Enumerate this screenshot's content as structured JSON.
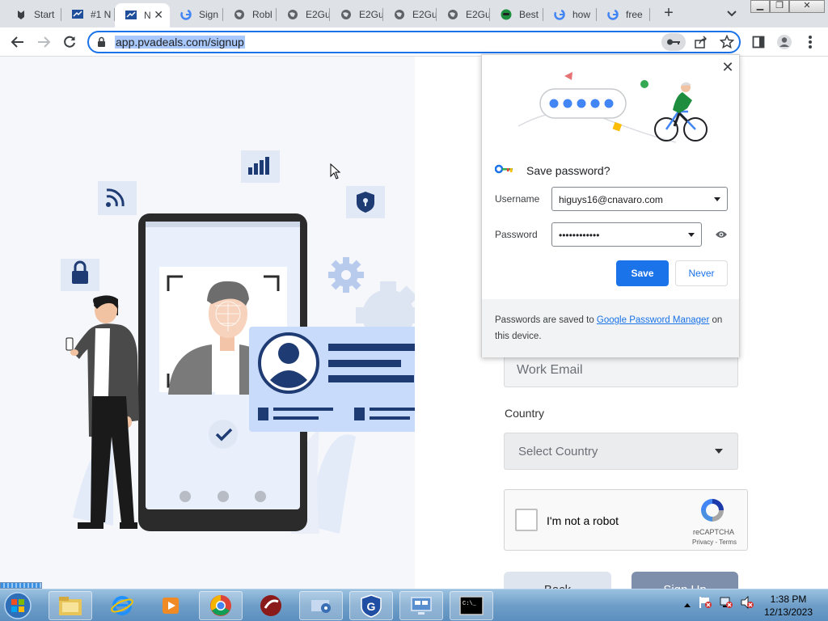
{
  "browser": {
    "tabs": [
      {
        "label": "Start",
        "icon": "owl-favicon"
      },
      {
        "label": "#1 N",
        "icon": "flag-favicon"
      },
      {
        "label": "N",
        "icon": "flag-favicon",
        "active": true
      },
      {
        "label": "Sign",
        "icon": "google-favicon"
      },
      {
        "label": "Robl",
        "icon": "globe-favicon"
      },
      {
        "label": "E2Gu",
        "icon": "globe-favicon"
      },
      {
        "label": "E2Gu",
        "icon": "globe-favicon"
      },
      {
        "label": "E2Gu",
        "icon": "globe-favicon"
      },
      {
        "label": "E2Gu",
        "icon": "globe-favicon"
      },
      {
        "label": "Best",
        "icon": "mask-favicon"
      },
      {
        "label": "how",
        "icon": "google-favicon"
      },
      {
        "label": "free",
        "icon": "google-favicon"
      }
    ],
    "url": "app.pvadeals.com/signup"
  },
  "form": {
    "email_placeholder": "Work Email",
    "country_label": "Country",
    "country_placeholder": "Select Country",
    "captcha_text": "I'm not a robot",
    "captcha_brand": "reCAPTCHA",
    "captcha_links": "Privacy - Terms",
    "back_label": "Back",
    "signup_label": "Sign Up"
  },
  "password_popup": {
    "title": "Save password?",
    "username_label": "Username",
    "username_value": "higuys16@cnavaro.com",
    "password_label": "Password",
    "password_value": "••••••••••••",
    "save_label": "Save",
    "never_label": "Never",
    "footer_prefix": "Passwords are saved to ",
    "footer_link": "Google Password Manager",
    "footer_suffix": " on this device."
  },
  "taskbar": {
    "time": "1:38 PM",
    "date": "12/13/2023"
  },
  "colors": {
    "accent": "#1a73e8",
    "illustration_blue": "#1f3b73",
    "card_bg": "#d4e3fa"
  }
}
